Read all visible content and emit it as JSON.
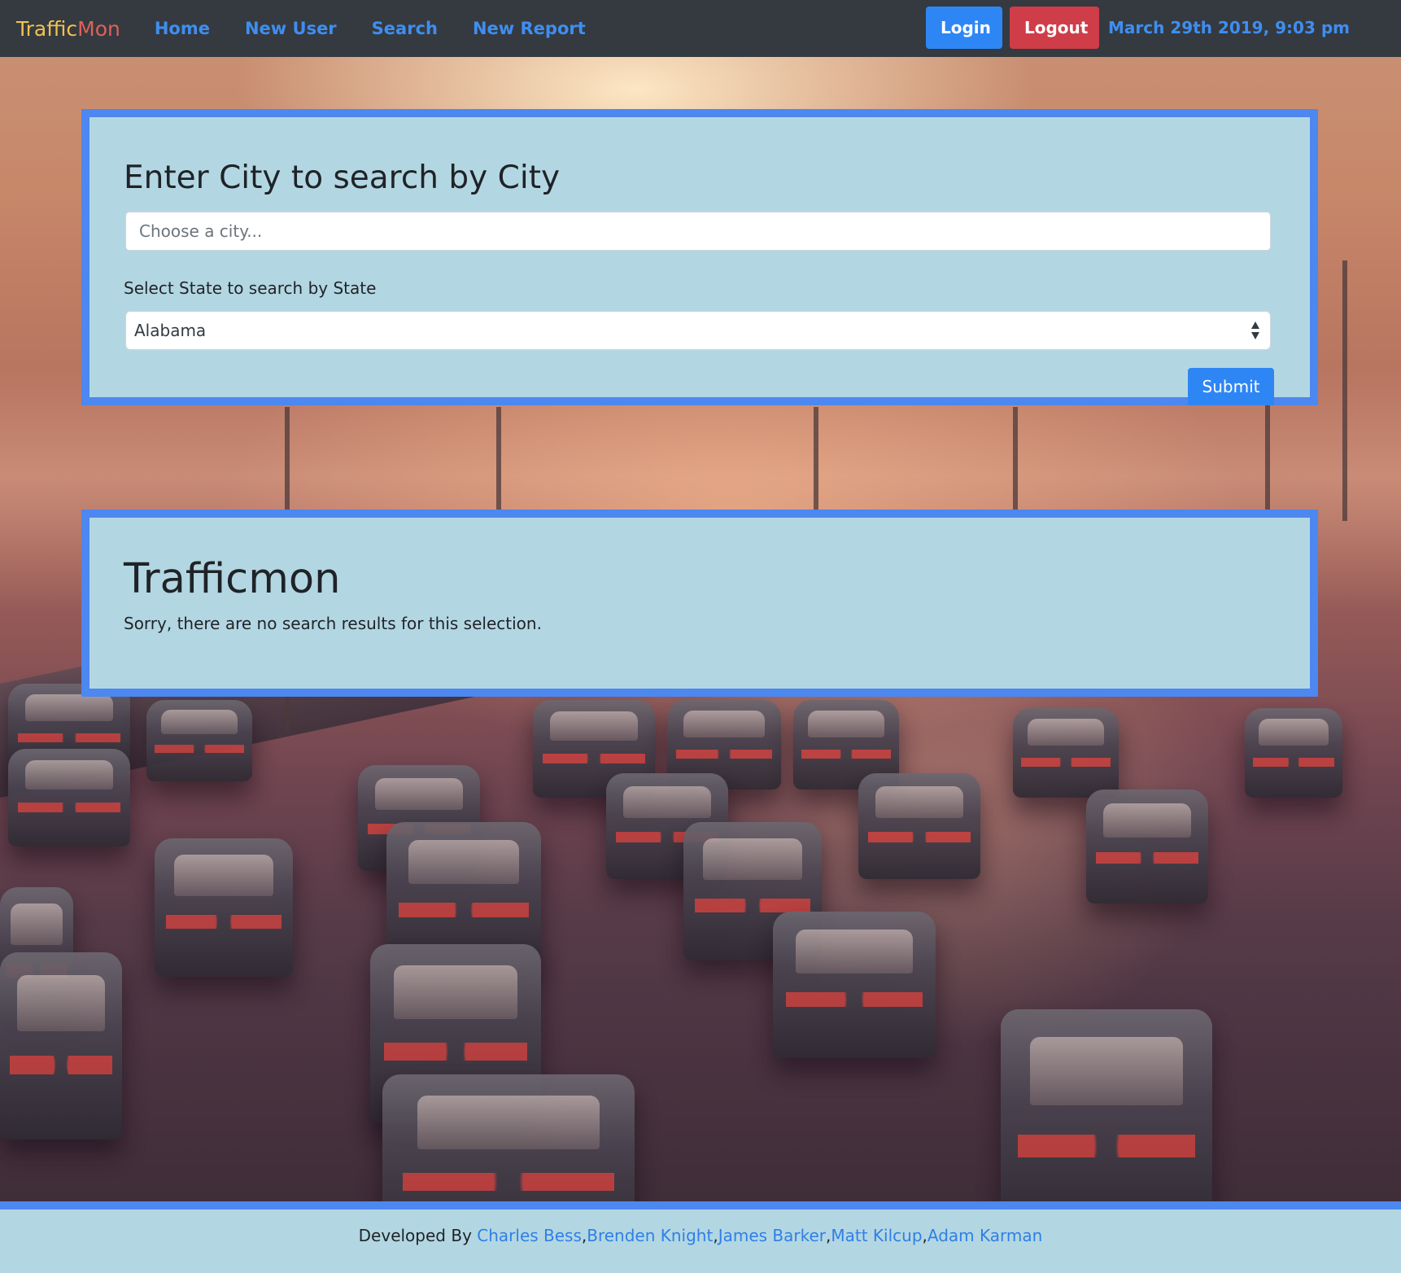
{
  "navbar": {
    "brand_part1": "Traffic",
    "brand_part2": "Mon",
    "links": [
      "Home",
      "New User",
      "Search",
      "New Report"
    ],
    "login_label": "Login",
    "logout_label": "Logout",
    "datetime": "March 29th 2019, 9:03 pm"
  },
  "search_card": {
    "title": "Enter City to search by City",
    "city_placeholder": "Choose a city...",
    "state_label": "Select State to search by State",
    "state_selected": "Alabama",
    "submit_label": "Submit"
  },
  "results_card": {
    "title": "Trafficmon",
    "message": "Sorry, there are no search results for this selection."
  },
  "footer": {
    "prefix": "Developed By ",
    "developers": [
      "Charles Bess",
      "Brenden Knight",
      "James Barker",
      "Matt Kilcup",
      "Adam Karman"
    ],
    "separator": ","
  },
  "colors": {
    "navbar_bg": "#343a40",
    "brand_traffic": "#f2c14e",
    "brand_mon": "#e0605a",
    "link_blue": "#3f8ef0",
    "login_bg": "#2e86f5",
    "logout_bg": "#cf3d48",
    "card_bg": "#b3d7e2",
    "card_border": "#4d87f0"
  },
  "background": {
    "description_icon": "highway-sunset-photo"
  }
}
